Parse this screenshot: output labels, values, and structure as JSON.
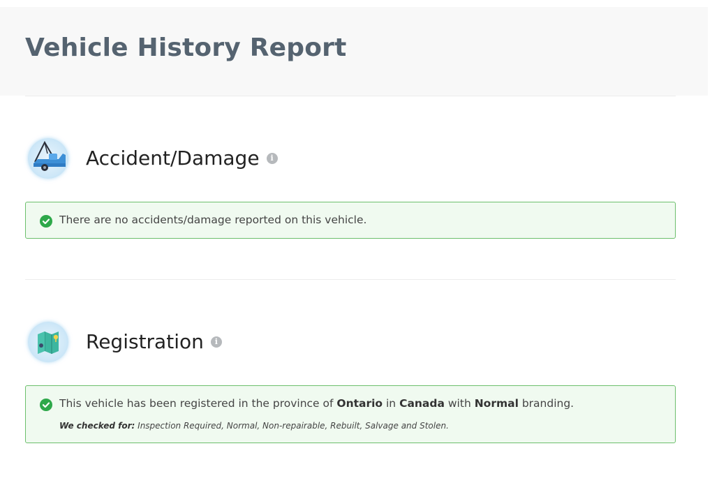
{
  "page": {
    "title": "Vehicle History Report"
  },
  "sections": [
    {
      "title": "Accident/Damage",
      "icon": "tow-truck-icon",
      "message": "There are no accidents/damage reported on this vehicle."
    },
    {
      "title": "Registration",
      "icon": "map-icon",
      "message_parts": {
        "prefix": "This vehicle has been registered in the province of ",
        "province": "Ontario",
        "in": " in ",
        "country": "Canada",
        "with": " with ",
        "branding": "Normal",
        "suffix": " branding."
      },
      "checked_for_label": "We checked for:",
      "checked_for_list": " Inspection Required, Normal, Non-repairable, Rebuilt, Salvage and Stolen."
    }
  ],
  "colors": {
    "success_green": "#2ea84a",
    "alert_border": "#6cbf6c",
    "alert_bg": "#f0faf0",
    "title_slate": "#556370"
  }
}
